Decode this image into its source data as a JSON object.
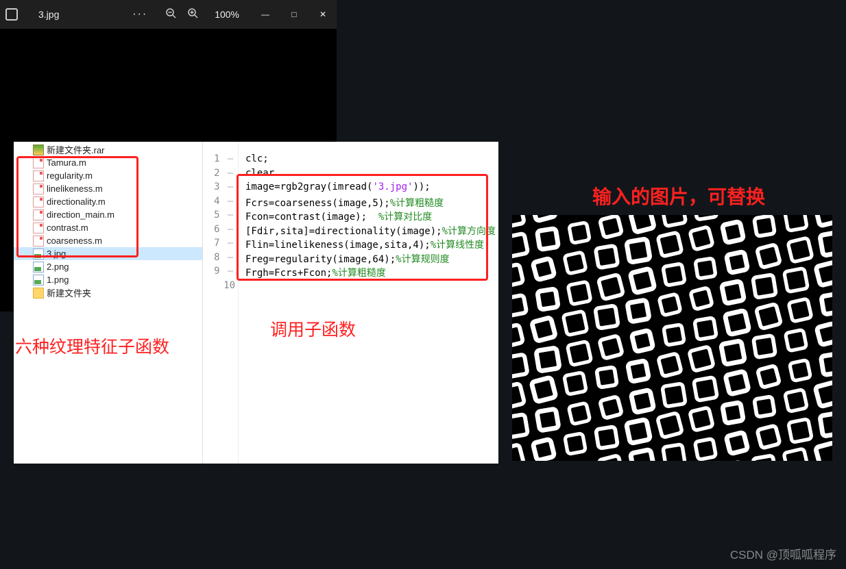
{
  "file_panel": {
    "items": [
      {
        "name": "新建文件夹.rar",
        "icon": "rar"
      },
      {
        "name": "Tamura.m",
        "icon": "m"
      },
      {
        "name": "regularity.m",
        "icon": "m"
      },
      {
        "name": "linelikeness.m",
        "icon": "m"
      },
      {
        "name": "directionality.m",
        "icon": "m"
      },
      {
        "name": "direction_main.m",
        "icon": "m"
      },
      {
        "name": "contrast.m",
        "icon": "m"
      },
      {
        "name": "coarseness.m",
        "icon": "m"
      },
      {
        "name": "3.jpg",
        "icon": "img",
        "selected": true
      },
      {
        "name": "2.png",
        "icon": "img"
      },
      {
        "name": "1.png",
        "icon": "img"
      },
      {
        "name": "新建文件夹",
        "icon": "folder"
      }
    ],
    "caption": "六种纹理特征子函数"
  },
  "code_panel": {
    "lines": [
      {
        "n": 1,
        "segs": [
          {
            "t": "clc;",
            "c": ""
          }
        ]
      },
      {
        "n": 2,
        "segs": [
          {
            "t": "clear",
            "c": ""
          }
        ]
      },
      {
        "n": 3,
        "segs": [
          {
            "t": "image=rgb2gray(imread(",
            "c": ""
          },
          {
            "t": "'3.jpg'",
            "c": "str"
          },
          {
            "t": "));",
            "c": ""
          }
        ]
      },
      {
        "n": 4,
        "segs": [
          {
            "t": "Fcrs=coarseness(image,5);",
            "c": ""
          },
          {
            "t": "%计算粗糙度",
            "c": "cmt"
          }
        ]
      },
      {
        "n": 5,
        "segs": [
          {
            "t": "Fcon=contrast(image);  ",
            "c": ""
          },
          {
            "t": "%计算对比度",
            "c": "cmt"
          }
        ]
      },
      {
        "n": 6,
        "segs": [
          {
            "t": "[Fdir,sita]=directionality(image);",
            "c": ""
          },
          {
            "t": "%计算方向度",
            "c": "cmt"
          }
        ]
      },
      {
        "n": 7,
        "segs": [
          {
            "t": "Flin=linelikeness(image,sita,4);",
            "c": ""
          },
          {
            "t": "%计算线性度",
            "c": "cmt"
          }
        ]
      },
      {
        "n": 8,
        "segs": [
          {
            "t": "Freg=regularity(image,64);",
            "c": ""
          },
          {
            "t": "%计算规则度",
            "c": "cmt"
          }
        ]
      },
      {
        "n": 9,
        "segs": [
          {
            "t": "Frgh=Fcrs+Fcon;",
            "c": ""
          },
          {
            "t": "%计算粗糙度",
            "c": "cmt"
          }
        ]
      },
      {
        "n": 10,
        "segs": []
      }
    ],
    "caption": "调用子函数"
  },
  "viewer": {
    "filename": "3.jpg",
    "zoom_level": "100%",
    "menu_dots": "···",
    "minimize": "—",
    "maximize": "□",
    "close": "✕",
    "caption": "输入的图片，可替换"
  },
  "watermark": "CSDN @顶呱呱程序"
}
